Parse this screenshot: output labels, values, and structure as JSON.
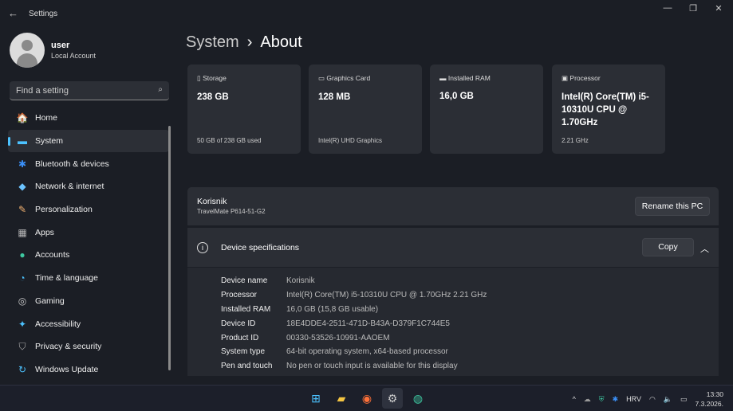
{
  "window": {
    "title": "Settings",
    "back": "←",
    "minimize": "—",
    "restore": "❐",
    "close": "✕"
  },
  "user": {
    "name": "user",
    "account": "Local Account"
  },
  "search": {
    "placeholder": "Find a setting",
    "icon": "⌕"
  },
  "nav": [
    {
      "label": "Home",
      "icon": "🏠",
      "color": "#f7a44a"
    },
    {
      "label": "System",
      "icon": "▬",
      "color": "#4cc2ff"
    },
    {
      "label": "Bluetooth & devices",
      "icon": "✱",
      "color": "#3a8ff7"
    },
    {
      "label": "Network & internet",
      "icon": "◆",
      "color": "#6cc4ff"
    },
    {
      "label": "Personalization",
      "icon": "✎",
      "color": "#f0b070"
    },
    {
      "label": "Apps",
      "icon": "▦",
      "color": "#bbbbbb"
    },
    {
      "label": "Accounts",
      "icon": "●",
      "color": "#3ec7a0"
    },
    {
      "label": "Time & language",
      "icon": "◔",
      "color": "#4cc2ff"
    },
    {
      "label": "Gaming",
      "icon": "◎",
      "color": "#cccccc"
    },
    {
      "label": "Accessibility",
      "icon": "✦",
      "color": "#4cc2ff"
    },
    {
      "label": "Privacy & security",
      "icon": "⛉",
      "color": "#aaaaaa"
    },
    {
      "label": "Windows Update",
      "icon": "↻",
      "color": "#4cc2ff"
    }
  ],
  "breadcrumb": {
    "parent": "System",
    "sep": "›",
    "current": "About"
  },
  "cards": [
    {
      "label": "Storage",
      "icon": "▯",
      "value": "238 GB",
      "sub": "50 GB of 238 GB used"
    },
    {
      "label": "Graphics Card",
      "icon": "▭",
      "value": "128 MB",
      "sub": "Intel(R) UHD Graphics"
    },
    {
      "label": "Installed RAM",
      "icon": "▬",
      "value": "16,0 GB",
      "sub": ""
    },
    {
      "label": "Processor",
      "icon": "▣",
      "value": "Intel(R) Core(TM) i5-10310U CPU @ 1.70GHz",
      "sub": "2.21 GHz"
    }
  ],
  "pc": {
    "name": "Korisnik",
    "model": "TravelMate P614-51-G2",
    "rename": "Rename this PC"
  },
  "specs": {
    "title": "Device specifications",
    "copy": "Copy",
    "info_icon": "i",
    "chevron": "︿",
    "rows": [
      {
        "k": "Device name",
        "v": "Korisnik"
      },
      {
        "k": "Processor",
        "v": "Intel(R) Core(TM) i5-10310U CPU @ 1.70GHz   2.21 GHz"
      },
      {
        "k": "Installed RAM",
        "v": "16,0 GB (15,8 GB usable)"
      },
      {
        "k": "Device ID",
        "v": "18E4DDE4-2511-471D-B43A-D379F1C744E5"
      },
      {
        "k": "Product ID",
        "v": "00330-53526-10991-AAOEM"
      },
      {
        "k": "System type",
        "v": "64-bit operating system, x64-based processor"
      },
      {
        "k": "Pen and touch",
        "v": "No pen or touch input is available for this display"
      }
    ]
  },
  "taskbar": {
    "apps": [
      {
        "name": "start",
        "icon": "⊞",
        "color": "#4cc2ff"
      },
      {
        "name": "file-explorer",
        "icon": "▰",
        "color": "#f5c542"
      },
      {
        "name": "firefox",
        "icon": "◉",
        "color": "#ff7139"
      },
      {
        "name": "settings",
        "icon": "⚙",
        "color": "#cccccc"
      },
      {
        "name": "edge",
        "icon": "◍",
        "color": "#3ec7a0"
      }
    ],
    "tray": {
      "chevron": "^",
      "lang": "HRV",
      "time": "13:30",
      "date": "7.3.2026."
    }
  }
}
